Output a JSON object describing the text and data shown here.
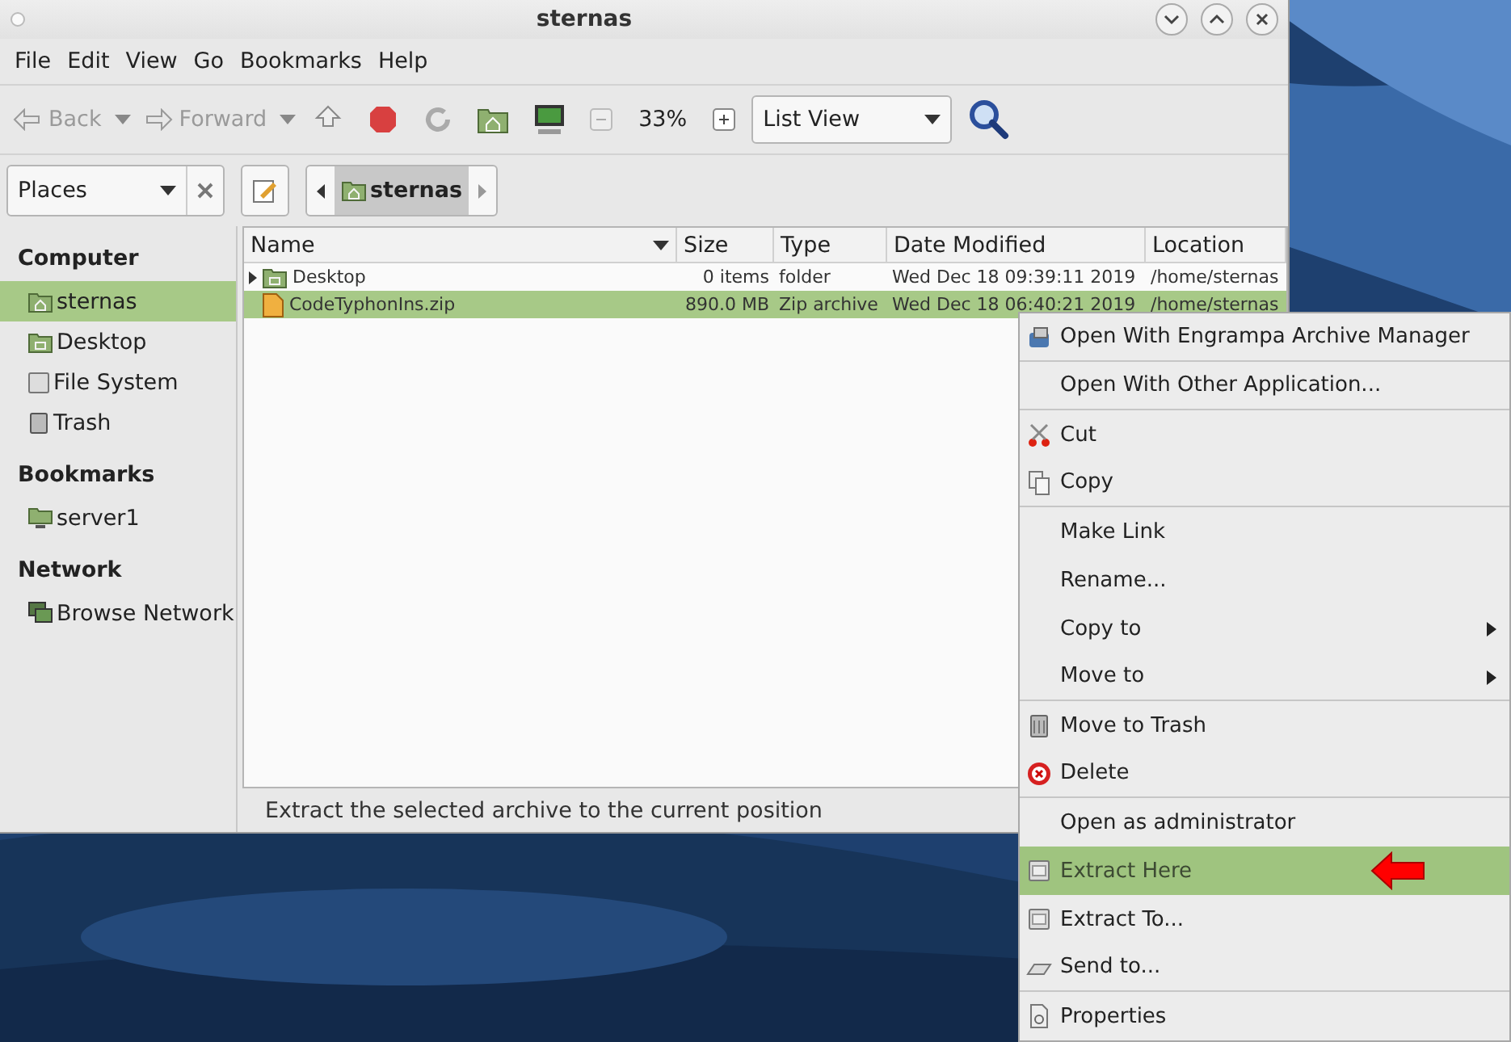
{
  "window": {
    "title": "sternas"
  },
  "menubar": [
    "File",
    "Edit",
    "View",
    "Go",
    "Bookmarks",
    "Help"
  ],
  "toolbar": {
    "back": {
      "label": "Back",
      "disabled": true
    },
    "forward": {
      "label": "Forward",
      "disabled": true
    },
    "zoom": "33%",
    "view": "List View"
  },
  "location_bar": {
    "places": "Places",
    "path": [
      {
        "label": "sternas",
        "selected": true
      }
    ]
  },
  "sidebar": [
    {
      "heading": "Computer",
      "items": [
        {
          "label": "sternas",
          "selected": true
        },
        {
          "label": "Desktop",
          "selected": false
        },
        {
          "label": "File System",
          "selected": false
        },
        {
          "label": "Trash",
          "selected": false
        }
      ]
    },
    {
      "heading": "Bookmarks",
      "items": [
        {
          "label": "server1",
          "selected": false
        }
      ]
    },
    {
      "heading": "Network",
      "items": [
        {
          "label": "Browse Network",
          "selected": false
        }
      ]
    }
  ],
  "table": {
    "columns": [
      "Name",
      "Size",
      "Type",
      "Date Modified",
      "Location"
    ],
    "rows": [
      {
        "kind": "folder",
        "expandable": true,
        "selected": false,
        "cells": [
          "Desktop",
          "0 items",
          "folder",
          "Wed Dec 18 09:39:11 2019",
          "/home/sternas"
        ]
      },
      {
        "kind": "archive",
        "expandable": false,
        "selected": true,
        "cells": [
          "CodeTyphonIns.zip",
          "890.0 MB",
          "Zip archive",
          "Wed Dec 18 06:40:21 2019",
          "/home/sternas"
        ]
      }
    ]
  },
  "status_bar": "Extract the selected archive to the current position",
  "context_menu": [
    {
      "label": "Open With Engrampa Archive Manager",
      "selected": false,
      "submenu": false,
      "separator_after": true
    },
    {
      "label": "Open With Other Application...",
      "selected": false,
      "submenu": false,
      "separator_after": true
    },
    {
      "label": "Cut",
      "selected": false,
      "submenu": false,
      "separator_after": false
    },
    {
      "label": "Copy",
      "selected": false,
      "submenu": false,
      "separator_after": true
    },
    {
      "label": "Make Link",
      "selected": false,
      "submenu": false,
      "separator_after": false
    },
    {
      "label": "Rename...",
      "selected": false,
      "submenu": false,
      "separator_after": false
    },
    {
      "label": "Copy to",
      "selected": false,
      "submenu": true,
      "separator_after": false
    },
    {
      "label": "Move to",
      "selected": false,
      "submenu": true,
      "separator_after": true
    },
    {
      "label": "Move to Trash",
      "selected": false,
      "submenu": false,
      "separator_after": false
    },
    {
      "label": "Delete",
      "selected": false,
      "submenu": false,
      "separator_after": true
    },
    {
      "label": "Open as administrator",
      "selected": false,
      "submenu": false,
      "separator_after": false
    },
    {
      "label": "Extract Here",
      "selected": true,
      "submenu": false,
      "separator_after": false
    },
    {
      "label": "Extract To...",
      "selected": false,
      "submenu": false,
      "separator_after": false
    },
    {
      "label": "Send to...",
      "selected": false,
      "submenu": false,
      "separator_after": true
    },
    {
      "label": "Properties",
      "selected": false,
      "submenu": false,
      "separator_after": false
    }
  ]
}
